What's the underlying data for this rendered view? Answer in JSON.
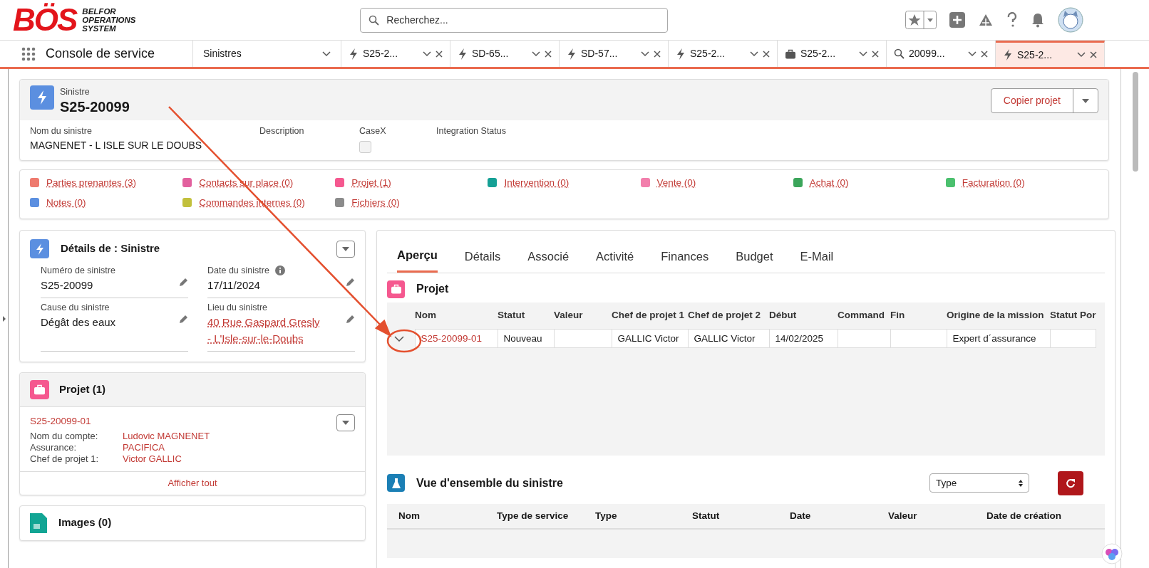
{
  "header": {
    "logo": "BÖS",
    "tagline": "BELFOR OPERATIONS SYSTEM",
    "search_placeholder": "Recherchez..."
  },
  "console": {
    "app_name": "Console de service",
    "nav_label": "Sinistres",
    "tabs": [
      {
        "kind": "bolt",
        "label": "S25-2...",
        "selected": false
      },
      {
        "kind": "bolt",
        "label": "SD-65...",
        "selected": false
      },
      {
        "kind": "bolt",
        "label": "SD-57...",
        "selected": false
      },
      {
        "kind": "bolt",
        "label": "S25-2...",
        "selected": false
      },
      {
        "kind": "briefcase",
        "label": "S25-2...",
        "selected": false
      },
      {
        "kind": "search",
        "label": "20099...",
        "selected": false
      },
      {
        "kind": "bolt",
        "label": "S25-2...",
        "selected": true
      }
    ]
  },
  "record": {
    "object_label": "Sinistre",
    "title": "S25-20099",
    "action": "Copier projet",
    "fields": [
      {
        "kind": "text",
        "label": "Nom du sinistre",
        "value": "MAGNENET - L ISLE SUR LE DOUBS"
      },
      {
        "kind": "text",
        "label": "Description"
      },
      {
        "kind": "checkbox",
        "label": "CaseX",
        "checked": false
      },
      {
        "kind": "text",
        "label": "Integration Status"
      }
    ]
  },
  "related_links": [
    {
      "label": "Parties prenantes (3)",
      "color": "#ee7a6e"
    },
    {
      "label": "Contacts sur place (0)",
      "color": "#e2609e"
    },
    {
      "label": "Projet (1)",
      "color": "#f5588f"
    },
    {
      "label": "Intervention (0)",
      "color": "#15a095"
    },
    {
      "label": "Vente (0)",
      "color": "#f27fac"
    },
    {
      "label": "Achat (0)",
      "color": "#3ba55a"
    },
    {
      "label": "Facturation (0)",
      "color": "#4bc06e"
    },
    {
      "label": "Notes (0)",
      "color": "#5b8fe0"
    },
    {
      "label": "Commandes internes (0)",
      "color": "#c2c03c"
    },
    {
      "label": "Fichiers (0)",
      "color": "#8b8b8b"
    }
  ],
  "details": {
    "title": "Détails de : Sinistre",
    "fields": [
      {
        "kind": "text",
        "label": "Numéro de sinistre",
        "value": "S25-20099",
        "info": false
      },
      {
        "kind": "text",
        "label": "Date du sinistre",
        "value": "17/11/2024",
        "info": true
      },
      {
        "kind": "text",
        "label": "Cause du sinistre",
        "value": "Dégât des eaux",
        "info": false
      },
      {
        "kind": "link",
        "label": "Lieu du sinistre",
        "value": "40 Rue Gaspard Gresly - L'Isle-sur-le-Doubs",
        "info": false
      }
    ]
  },
  "projet_card": {
    "title": "Projet (1)",
    "record": "S25-20099-01",
    "rows": [
      {
        "label": "Nom du compte:",
        "value": "Ludovic MAGNENET"
      },
      {
        "label": "Assurance:",
        "value": "PACIFICA"
      },
      {
        "label": "Chef de projet 1:",
        "value": "Victor GALLIC"
      }
    ],
    "footer": "Afficher tout"
  },
  "images_card": {
    "title": "Images (0)"
  },
  "main_tabs": [
    {
      "label": "Aperçu",
      "selected": true
    },
    {
      "label": "Détails",
      "selected": false
    },
    {
      "label": "Associé",
      "selected": false
    },
    {
      "label": "Activité",
      "selected": false
    },
    {
      "label": "Finances",
      "selected": false
    },
    {
      "label": "Budget",
      "selected": false
    },
    {
      "label": "E-Mail",
      "selected": false
    }
  ],
  "projet_section": {
    "title": "Projet",
    "columns": [
      "Nom",
      "Statut",
      "Valeur",
      "Chef de projet 1",
      "Chef de projet 2",
      "Début",
      "Command",
      "Fin",
      "Origine de la mission",
      "Statut Por"
    ],
    "rows": [
      {
        "expanded": false,
        "cells": [
          "S25-20099-01",
          "Nouveau",
          null,
          "GALLIC Victor",
          "GALLIC Victor",
          "14/02/2025",
          null,
          null,
          "Expert d´assurance",
          null
        ]
      }
    ]
  },
  "overview": {
    "title": "Vue d'ensemble du sinistre",
    "filter": "Type",
    "columns": [
      "Nom",
      "Type de service",
      "Type",
      "Statut",
      "Date",
      "Valeur",
      "Date de création"
    ]
  }
}
